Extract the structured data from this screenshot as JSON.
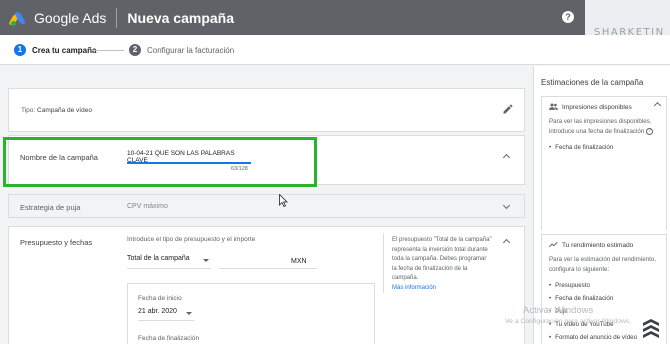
{
  "header": {
    "app_name": "Google Ads",
    "page_title": "Nueva campaña",
    "help_glyph": "?",
    "watermark_brand": "SHARKETIN"
  },
  "stepper": {
    "steps": [
      {
        "number": "1",
        "label": "Crea tu campaña",
        "active": true
      },
      {
        "number": "2",
        "label": "Configurar la facturación",
        "active": false
      }
    ]
  },
  "campaign_type": {
    "label_prefix": "Tipo:",
    "value": "Campaña de vídeo"
  },
  "campaign_name": {
    "label": "Nombre de la campaña",
    "value": "10-04-21 QUE SON LAS PALABRAS CLAVE",
    "counter": "63/128"
  },
  "bidding": {
    "label": "Estrategia de puja",
    "value": "CPV máximo"
  },
  "budget": {
    "label": "Presupuesto y fechas",
    "intro": "Introduce el tipo de presupuesto y el importe",
    "type_selected": "Total de la campaña",
    "currency": "MXN",
    "help_text": "El presupuesto \"Total de la campaña\" representa la inversión total durante toda la campaña. Debes programar la fecha de finalización de la campaña.",
    "help_link": "Más información",
    "start_date_label": "Fecha de inicio",
    "start_date_value": "21 abr. 2020",
    "end_date_label": "Fecha de finalización"
  },
  "side_panel": {
    "title": "Estimaciones de la campaña",
    "impressions": {
      "title": "Impresiones disponibles",
      "text": "Para ver las impresiones disponibles, introduce una fecha de finalización",
      "bullets": [
        "Fecha de finalización"
      ]
    },
    "performance": {
      "title": "Tu rendimiento estimado",
      "text": "Para ver la estimación del rendimiento, configura lo siguiente:",
      "bullets": [
        "Presupuesto",
        "Fecha de finalización",
        "Puja",
        "Tu vídeo de YouTube",
        "Formato del anuncio de vídeo"
      ]
    }
  },
  "windows_notice": {
    "title": "Activar Windows",
    "subtitle": "Ve a Configuración para activar Windows."
  },
  "colors": {
    "header": "#5f6368",
    "accent": "#1a73e8",
    "highlight": "#2bb32e"
  }
}
